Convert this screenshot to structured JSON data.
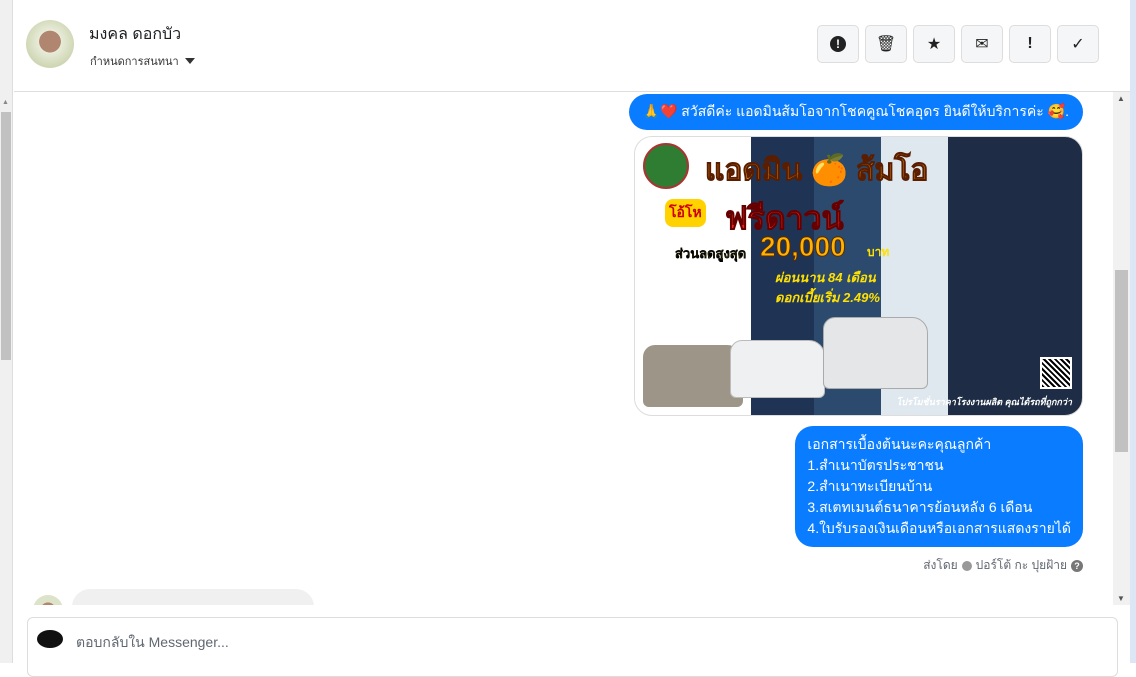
{
  "header": {
    "contact_name": "มงคล ดอกบัว",
    "assign_label": "กำหนดการสนทนา",
    "actions": [
      {
        "icon": "alert-circle-icon",
        "glyph": "!"
      },
      {
        "icon": "trash-icon",
        "glyph": "🗑"
      },
      {
        "icon": "star-icon",
        "glyph": "★"
      },
      {
        "icon": "envelope-icon",
        "glyph": "✉"
      },
      {
        "icon": "exclamation-icon",
        "glyph": "!"
      },
      {
        "icon": "check-icon",
        "glyph": "✓"
      }
    ]
  },
  "messages": {
    "greeting": "🙏❤️ สวัสดีค่ะ แอดมินส้มโอจากโชคคูณโชคอุดร ยินดีให้บริการค่ะ 🥰.",
    "promo_image": {
      "title": "แอดมิน 🍊 ส้มโอ",
      "badge": "โอ้โห",
      "headline": "ฟรีดาวน์",
      "discount_label": "ส่วนลดสูงสุด",
      "discount_amount": "20,000",
      "currency": "บาท",
      "installment": "ผ่อนนาน 84 เดือน",
      "interest": "ดอกเบี้ยเริ่ม 2.49%",
      "footer": "โปรโมชั่นราคาโรงงานผลิต คุณได้รถที่ถูกกว่า"
    },
    "documents": [
      "เอกสารเบื้องต้นนะคะคุณลูกค้า",
      "1.สำเนาบัตรประชาชน",
      "2.สำเนาทะเบียนบ้าน",
      "3.สเตทเมนต์ธนาคารย้อนหลัง 6 เดือน",
      "4.ใบรับรองเงินเดือนหรือเอกสารแสดงรายได้"
    ],
    "sent_by_label": "ส่งโดย",
    "sent_by_name": "ปอร์โต้ กะ ปุยฝ้าย"
  },
  "composer": {
    "placeholder": "ตอบกลับใน Messenger..."
  },
  "colors": {
    "accent": "#0a7cff",
    "incoming": "#f1f0f0"
  }
}
